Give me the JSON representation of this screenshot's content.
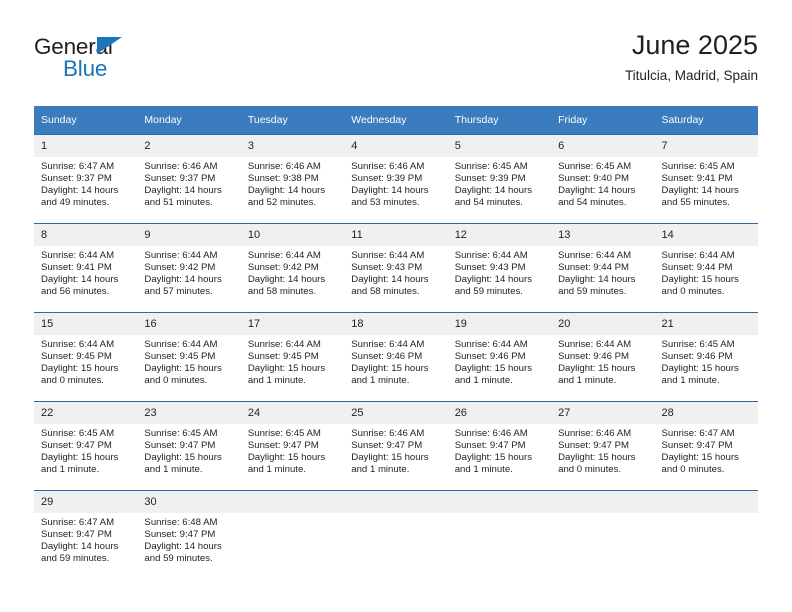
{
  "brand": {
    "name_top": "General",
    "name_bottom": "Blue",
    "accent_color": "#1b75bb"
  },
  "header": {
    "title": "June 2025",
    "subtitle": "Titulcia, Madrid, Spain"
  },
  "calendar": {
    "header_bg": "#3a7cbe",
    "row_rule_color": "#2d6ca8",
    "daynum_bg": "#f0f0f0",
    "weekdays": [
      "Sunday",
      "Monday",
      "Tuesday",
      "Wednesday",
      "Thursday",
      "Friday",
      "Saturday"
    ],
    "weeks": [
      [
        {
          "day": "1",
          "sunrise": "Sunrise: 6:47 AM",
          "sunset": "Sunset: 9:37 PM",
          "daylight_1": "Daylight: 14 hours",
          "daylight_2": "and 49 minutes."
        },
        {
          "day": "2",
          "sunrise": "Sunrise: 6:46 AM",
          "sunset": "Sunset: 9:37 PM",
          "daylight_1": "Daylight: 14 hours",
          "daylight_2": "and 51 minutes."
        },
        {
          "day": "3",
          "sunrise": "Sunrise: 6:46 AM",
          "sunset": "Sunset: 9:38 PM",
          "daylight_1": "Daylight: 14 hours",
          "daylight_2": "and 52 minutes."
        },
        {
          "day": "4",
          "sunrise": "Sunrise: 6:46 AM",
          "sunset": "Sunset: 9:39 PM",
          "daylight_1": "Daylight: 14 hours",
          "daylight_2": "and 53 minutes."
        },
        {
          "day": "5",
          "sunrise": "Sunrise: 6:45 AM",
          "sunset": "Sunset: 9:39 PM",
          "daylight_1": "Daylight: 14 hours",
          "daylight_2": "and 54 minutes."
        },
        {
          "day": "6",
          "sunrise": "Sunrise: 6:45 AM",
          "sunset": "Sunset: 9:40 PM",
          "daylight_1": "Daylight: 14 hours",
          "daylight_2": "and 54 minutes."
        },
        {
          "day": "7",
          "sunrise": "Sunrise: 6:45 AM",
          "sunset": "Sunset: 9:41 PM",
          "daylight_1": "Daylight: 14 hours",
          "daylight_2": "and 55 minutes."
        }
      ],
      [
        {
          "day": "8",
          "sunrise": "Sunrise: 6:44 AM",
          "sunset": "Sunset: 9:41 PM",
          "daylight_1": "Daylight: 14 hours",
          "daylight_2": "and 56 minutes."
        },
        {
          "day": "9",
          "sunrise": "Sunrise: 6:44 AM",
          "sunset": "Sunset: 9:42 PM",
          "daylight_1": "Daylight: 14 hours",
          "daylight_2": "and 57 minutes."
        },
        {
          "day": "10",
          "sunrise": "Sunrise: 6:44 AM",
          "sunset": "Sunset: 9:42 PM",
          "daylight_1": "Daylight: 14 hours",
          "daylight_2": "and 58 minutes."
        },
        {
          "day": "11",
          "sunrise": "Sunrise: 6:44 AM",
          "sunset": "Sunset: 9:43 PM",
          "daylight_1": "Daylight: 14 hours",
          "daylight_2": "and 58 minutes."
        },
        {
          "day": "12",
          "sunrise": "Sunrise: 6:44 AM",
          "sunset": "Sunset: 9:43 PM",
          "daylight_1": "Daylight: 14 hours",
          "daylight_2": "and 59 minutes."
        },
        {
          "day": "13",
          "sunrise": "Sunrise: 6:44 AM",
          "sunset": "Sunset: 9:44 PM",
          "daylight_1": "Daylight: 14 hours",
          "daylight_2": "and 59 minutes."
        },
        {
          "day": "14",
          "sunrise": "Sunrise: 6:44 AM",
          "sunset": "Sunset: 9:44 PM",
          "daylight_1": "Daylight: 15 hours",
          "daylight_2": "and 0 minutes."
        }
      ],
      [
        {
          "day": "15",
          "sunrise": "Sunrise: 6:44 AM",
          "sunset": "Sunset: 9:45 PM",
          "daylight_1": "Daylight: 15 hours",
          "daylight_2": "and 0 minutes."
        },
        {
          "day": "16",
          "sunrise": "Sunrise: 6:44 AM",
          "sunset": "Sunset: 9:45 PM",
          "daylight_1": "Daylight: 15 hours",
          "daylight_2": "and 0 minutes."
        },
        {
          "day": "17",
          "sunrise": "Sunrise: 6:44 AM",
          "sunset": "Sunset: 9:45 PM",
          "daylight_1": "Daylight: 15 hours",
          "daylight_2": "and 1 minute."
        },
        {
          "day": "18",
          "sunrise": "Sunrise: 6:44 AM",
          "sunset": "Sunset: 9:46 PM",
          "daylight_1": "Daylight: 15 hours",
          "daylight_2": "and 1 minute."
        },
        {
          "day": "19",
          "sunrise": "Sunrise: 6:44 AM",
          "sunset": "Sunset: 9:46 PM",
          "daylight_1": "Daylight: 15 hours",
          "daylight_2": "and 1 minute."
        },
        {
          "day": "20",
          "sunrise": "Sunrise: 6:44 AM",
          "sunset": "Sunset: 9:46 PM",
          "daylight_1": "Daylight: 15 hours",
          "daylight_2": "and 1 minute."
        },
        {
          "day": "21",
          "sunrise": "Sunrise: 6:45 AM",
          "sunset": "Sunset: 9:46 PM",
          "daylight_1": "Daylight: 15 hours",
          "daylight_2": "and 1 minute."
        }
      ],
      [
        {
          "day": "22",
          "sunrise": "Sunrise: 6:45 AM",
          "sunset": "Sunset: 9:47 PM",
          "daylight_1": "Daylight: 15 hours",
          "daylight_2": "and 1 minute."
        },
        {
          "day": "23",
          "sunrise": "Sunrise: 6:45 AM",
          "sunset": "Sunset: 9:47 PM",
          "daylight_1": "Daylight: 15 hours",
          "daylight_2": "and 1 minute."
        },
        {
          "day": "24",
          "sunrise": "Sunrise: 6:45 AM",
          "sunset": "Sunset: 9:47 PM",
          "daylight_1": "Daylight: 15 hours",
          "daylight_2": "and 1 minute."
        },
        {
          "day": "25",
          "sunrise": "Sunrise: 6:46 AM",
          "sunset": "Sunset: 9:47 PM",
          "daylight_1": "Daylight: 15 hours",
          "daylight_2": "and 1 minute."
        },
        {
          "day": "26",
          "sunrise": "Sunrise: 6:46 AM",
          "sunset": "Sunset: 9:47 PM",
          "daylight_1": "Daylight: 15 hours",
          "daylight_2": "and 1 minute."
        },
        {
          "day": "27",
          "sunrise": "Sunrise: 6:46 AM",
          "sunset": "Sunset: 9:47 PM",
          "daylight_1": "Daylight: 15 hours",
          "daylight_2": "and 0 minutes."
        },
        {
          "day": "28",
          "sunrise": "Sunrise: 6:47 AM",
          "sunset": "Sunset: 9:47 PM",
          "daylight_1": "Daylight: 15 hours",
          "daylight_2": "and 0 minutes."
        }
      ],
      [
        {
          "day": "29",
          "sunrise": "Sunrise: 6:47 AM",
          "sunset": "Sunset: 9:47 PM",
          "daylight_1": "Daylight: 14 hours",
          "daylight_2": "and 59 minutes."
        },
        {
          "day": "30",
          "sunrise": "Sunrise: 6:48 AM",
          "sunset": "Sunset: 9:47 PM",
          "daylight_1": "Daylight: 14 hours",
          "daylight_2": "and 59 minutes."
        },
        {
          "day": "",
          "sunrise": "",
          "sunset": "",
          "daylight_1": "",
          "daylight_2": ""
        },
        {
          "day": "",
          "sunrise": "",
          "sunset": "",
          "daylight_1": "",
          "daylight_2": ""
        },
        {
          "day": "",
          "sunrise": "",
          "sunset": "",
          "daylight_1": "",
          "daylight_2": ""
        },
        {
          "day": "",
          "sunrise": "",
          "sunset": "",
          "daylight_1": "",
          "daylight_2": ""
        },
        {
          "day": "",
          "sunrise": "",
          "sunset": "",
          "daylight_1": "",
          "daylight_2": ""
        }
      ]
    ]
  }
}
